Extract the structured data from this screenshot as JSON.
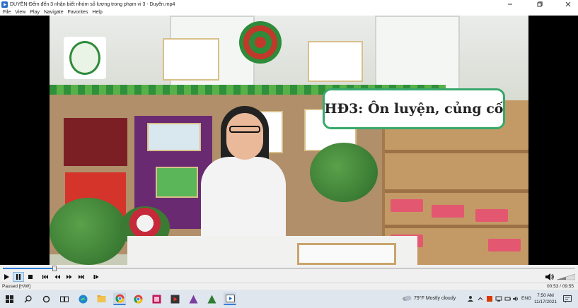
{
  "window": {
    "title": "DUYÊN-Đếm đến 3 nhận biết nhóm số lượng trong phạm vi 3 - Duyên.mp4",
    "controls": [
      "minimize",
      "maximize",
      "close"
    ]
  },
  "menu": {
    "items": [
      "File",
      "View",
      "Play",
      "Navigate",
      "Favorites",
      "Help"
    ]
  },
  "video": {
    "caption": "HĐ3: Ôn luyện, củng cố",
    "progress": 0.09
  },
  "playback": {
    "buttons": [
      {
        "name": "play-button",
        "icon": "play-icon"
      },
      {
        "name": "pause-button",
        "icon": "pause-icon",
        "active": true
      },
      {
        "name": "stop-button",
        "icon": "stop-icon"
      },
      {
        "name": "skip-back-button",
        "icon": "skip-back-icon"
      },
      {
        "name": "rewind-button",
        "icon": "rewind-icon"
      },
      {
        "name": "fast-forward-button",
        "icon": "fast-forward-icon"
      },
      {
        "name": "skip-forward-button",
        "icon": "skip-forward-icon"
      },
      {
        "name": "frame-step-button",
        "icon": "frame-step-icon"
      }
    ],
    "volume_level": 0.5
  },
  "status": {
    "state": "Paused [H/W]",
    "time": "00:53 / 09:55"
  },
  "taskbar": {
    "apps": [
      "start",
      "search",
      "task-view",
      "widgets",
      "edge",
      "files",
      "chrome",
      "chrome-2",
      "photos",
      "media-app",
      "onenote",
      "app-8",
      "media-player"
    ],
    "weather": "79°F  Mostly cloudy",
    "language": "ENG",
    "time": "7:50 AM",
    "date": "11/17/2021"
  },
  "colors": {
    "accent": "#3c7fd6",
    "caption_border": "#39a86b",
    "seek_fill": "#2a7ad6"
  }
}
